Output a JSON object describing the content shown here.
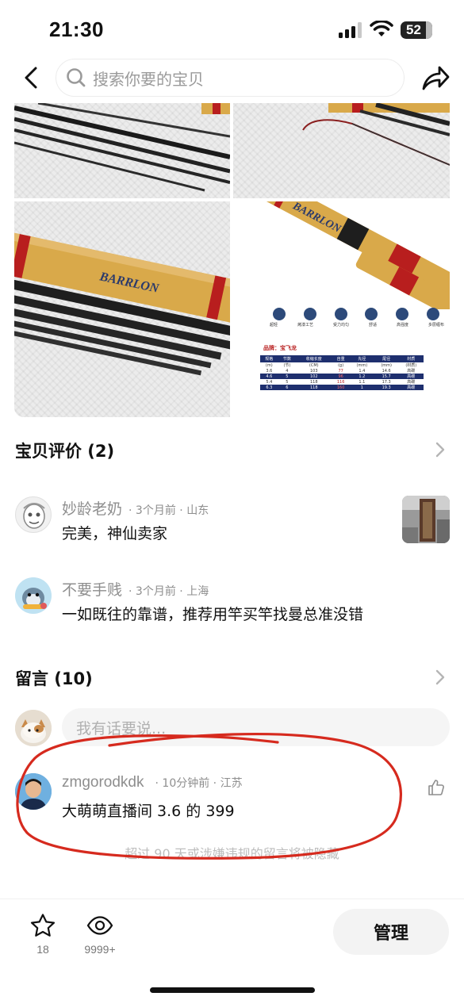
{
  "status_bar": {
    "time": "21:30",
    "battery": "52"
  },
  "nav": {
    "search_placeholder": "搜索你要的宝贝"
  },
  "product_image": {
    "brand_logo": "BARRLON",
    "feature_labels": [
      "超轻",
      "烤漆工艺",
      "受力均匀",
      "舒适",
      "高强度",
      "多层缠布"
    ],
    "spec_title": "品牌：宝飞龙",
    "spec_headers": [
      "规格",
      "节数",
      "收缩长度",
      "自重",
      "先径",
      "尾径",
      "材质"
    ],
    "spec_units": [
      "(m)",
      "(节)",
      "(CM)",
      "(g)",
      "(mm)",
      "(mm)",
      "(材质)"
    ],
    "spec_rows": [
      [
        "3.6",
        "4",
        "103",
        "77",
        "1.4",
        "14.6",
        "高碳"
      ],
      [
        "4.6",
        "5",
        "102",
        "96",
        "1.2",
        "15.7",
        "高碳"
      ],
      [
        "5.4",
        "5",
        "118",
        "116",
        "1.1",
        "17.3",
        "高碳"
      ],
      [
        "6.3",
        "6",
        "118",
        "160",
        "1",
        "19.3",
        "高碳"
      ]
    ]
  },
  "reviews": {
    "title": "宝贝评价 (2)",
    "items": [
      {
        "name": "妙龄老奶",
        "time": "3个月前",
        "location": "山东",
        "text": "完美，神仙卖家"
      },
      {
        "name": "不要手贱",
        "time": "3个月前",
        "location": "上海",
        "text": "一如既往的靠谱，推荐用竿买竿找曼总准没错"
      }
    ]
  },
  "messages": {
    "title": "留言 (10)",
    "input_placeholder": "我有话要说...",
    "items": [
      {
        "name": "zmgorodkdk",
        "time": "10分钟前",
        "location": "江苏",
        "text": "大萌萌直播间 3.6 的 399"
      }
    ],
    "hint": "超过 90 天或涉嫌违规的留言将被隐藏"
  },
  "bottom_bar": {
    "favorite_count": "18",
    "view_count": "9999+",
    "manage_label": "管理"
  },
  "colors": {
    "annotation_red": "#d62a1e",
    "rod_gold": "#d9a94a",
    "rod_red": "#b81e1e"
  },
  "icons": [
    "back-icon",
    "search-icon",
    "share-icon",
    "chevron-right-icon",
    "like-icon",
    "star-icon",
    "eye-icon"
  ]
}
